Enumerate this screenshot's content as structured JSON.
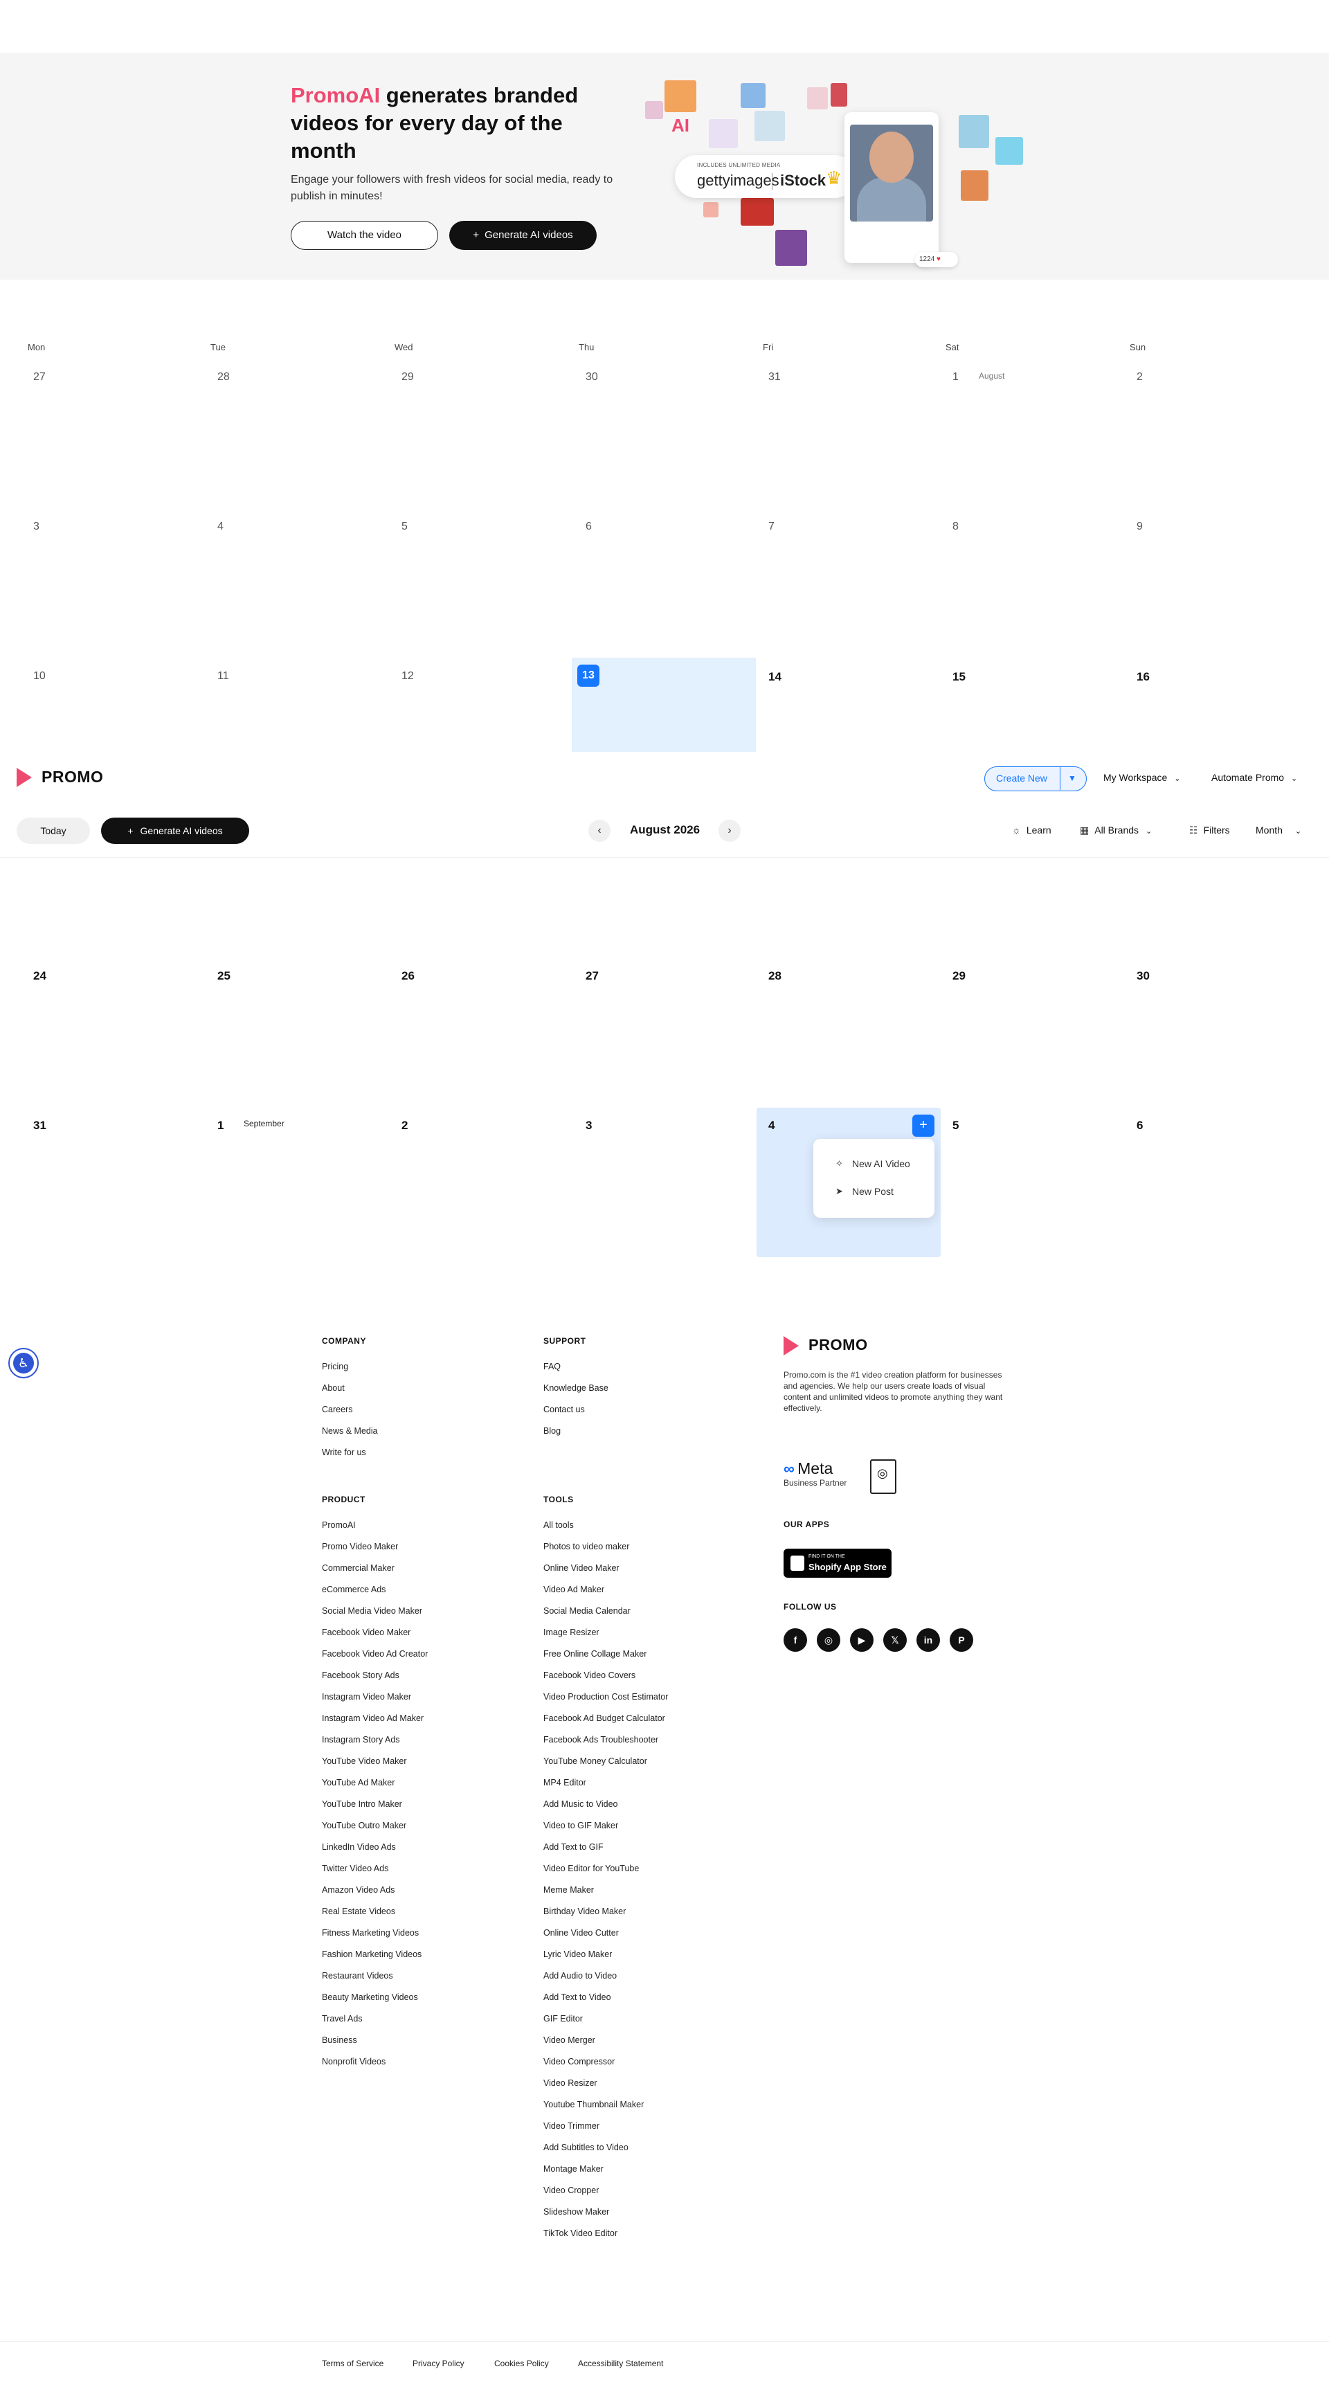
{
  "hero": {
    "title_brand": "PromoAI",
    "title_rest": " generates branded videos for every day of the month",
    "subtitle": "Engage your followers with fresh videos for social media, ready to publish in minutes!",
    "watch_label": "Watch the video",
    "generate_label": "Generate AI videos",
    "generate_icon": "plus-icon",
    "collage": {
      "ai_label": "AI",
      "included": "INCLUDES UNLIMITED MEDIA",
      "getty": "gettyimages",
      "istock": "iStock",
      "likes": "1224"
    }
  },
  "calendar": {
    "weekdays": [
      "Mon",
      "Tue",
      "Wed",
      "Thu",
      "Fri",
      "Sat",
      "Sun"
    ],
    "rows_top": [
      [
        "27",
        "28",
        "29",
        "30",
        "31",
        "1",
        "2"
      ],
      [
        "3",
        "4",
        "5",
        "6",
        "7",
        "8",
        "9"
      ],
      [
        "10",
        "11",
        "12",
        "13",
        "14",
        "15",
        "16"
      ]
    ],
    "rows_bottom": [
      [
        "24",
        "25",
        "26",
        "27",
        "28",
        "29",
        "30"
      ],
      [
        "31",
        "1",
        "2",
        "3",
        "4",
        "5",
        "6"
      ]
    ],
    "august_tag": "August",
    "september_tag": "September",
    "today_value": "13",
    "today_color": "#1677ff"
  },
  "header": {
    "logo_text": "PROMO",
    "create_new": "Create New",
    "my_workspace": "My Workspace",
    "automate": "Automate Promo",
    "today": "Today",
    "generate": "Generate AI videos",
    "month_title": "August 2026",
    "learn": "Learn",
    "all_brands": "All Brands",
    "filters": "Filters",
    "view": "Month"
  },
  "popup": {
    "new_ai_video": "New AI Video",
    "new_post": "New Post"
  },
  "footer": {
    "company": {
      "heading": "COMPANY",
      "links": [
        "Pricing",
        "About",
        "Careers",
        "News & Media",
        "Write for us"
      ]
    },
    "support": {
      "heading": "SUPPORT",
      "links": [
        "FAQ",
        "Knowledge Base",
        "Contact us",
        "Blog"
      ]
    },
    "product": {
      "heading": "PRODUCT",
      "links": [
        "PromoAI",
        "Promo Video Maker",
        "Commercial Maker",
        "eCommerce Ads",
        "Social Media Video Maker",
        "Facebook Video Maker",
        "Facebook Video Ad Creator",
        "Facebook Story Ads",
        "Instagram Video Maker",
        "Instagram Video Ad Maker",
        "Instagram Story Ads",
        "YouTube Video Maker",
        "YouTube Ad Maker",
        "YouTube Intro Maker",
        "YouTube Outro Maker",
        "LinkedIn Video Ads",
        "Twitter Video Ads",
        "Amazon Video Ads",
        "Real Estate Videos",
        "Fitness Marketing Videos",
        "Fashion Marketing Videos",
        "Restaurant Videos",
        "Beauty Marketing Videos",
        "Travel Ads",
        "Business",
        "Nonprofit Videos"
      ]
    },
    "tools": {
      "heading": "TOOLS",
      "links": [
        "All tools",
        "Photos to video maker",
        "Online Video Maker",
        "Video Ad Maker",
        "Social Media Calendar",
        "Image Resizer",
        "Free Online Collage Maker",
        "Facebook Video Covers",
        "Video Production Cost Estimator",
        "Facebook Ad Budget Calculator",
        "Facebook Ads Troubleshooter",
        "YouTube Money Calculator",
        "MP4 Editor",
        "Add Music to Video",
        "Video to GIF Maker",
        "Add Text to GIF",
        "Video Editor for YouTube",
        "Meme Maker",
        "Birthday Video Maker",
        "Online Video Cutter",
        "Lyric Video Maker",
        "Add Audio to Video",
        "Add Text to Video",
        "GIF Editor",
        "Video Merger",
        "Video Compressor",
        "Video Resizer",
        "Youtube Thumbnail Maker",
        "Video Trimmer",
        "Add Subtitles to Video",
        "Montage Maker",
        "Video Cropper",
        "Slideshow Maker",
        "TikTok Video Editor"
      ]
    },
    "brand_logo": "PROMO",
    "description": "Promo.com is the #1 video creation platform for businesses and agencies. We help our users create loads of visual content and unlimited videos to promote anything they want effectively.",
    "meta_label": "Meta",
    "meta_sub": "Business Partner",
    "our_apps": "OUR APPS",
    "shopify_small": "FIND IT ON THE",
    "shopify_big": "Shopify App Store",
    "follow_us": "FOLLOW US",
    "socials": [
      {
        "name": "facebook-icon",
        "glyph": "f"
      },
      {
        "name": "instagram-icon",
        "glyph": "◎"
      },
      {
        "name": "youtube-icon",
        "glyph": "▶"
      },
      {
        "name": "x-icon",
        "glyph": "𝕏"
      },
      {
        "name": "linkedin-icon",
        "glyph": "in"
      },
      {
        "name": "pinterest-icon",
        "glyph": "P"
      }
    ],
    "legal": [
      "Terms of Service",
      "Privacy Policy",
      "Cookies Policy",
      "Accessibility Statement"
    ]
  },
  "colors": {
    "brand_pink": "#ee4a70",
    "accent_blue": "#1677ff",
    "hero_bg": "#f5f5f5"
  }
}
